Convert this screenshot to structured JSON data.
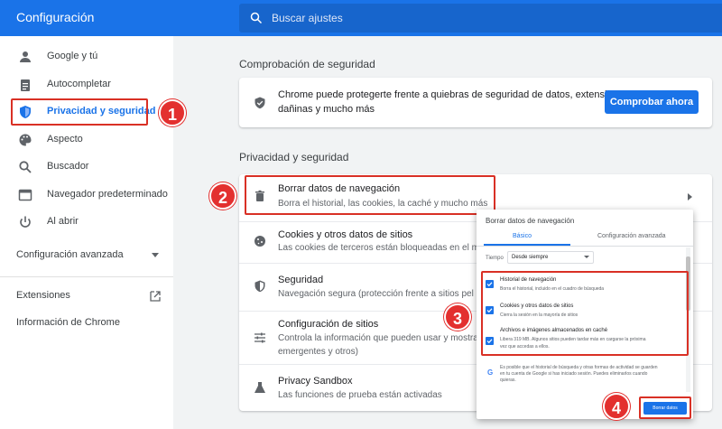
{
  "header": {
    "title": "Configuración",
    "search_placeholder": "Buscar ajustes"
  },
  "sidebar": {
    "items": [
      {
        "label": "Google y tú",
        "icon": "person-icon"
      },
      {
        "label": "Autocompletar",
        "icon": "clipboard-icon"
      },
      {
        "label": "Privacidad y seguridad",
        "icon": "shield-icon",
        "active": true
      },
      {
        "label": "Aspecto",
        "icon": "palette-icon"
      },
      {
        "label": "Buscador",
        "icon": "search-icon"
      },
      {
        "label": "Navegador predeterminado",
        "icon": "browser-window-icon"
      },
      {
        "label": "Al abrir",
        "icon": "power-icon"
      }
    ],
    "advanced_label": "Configuración avanzada",
    "extensions_label": "Extensiones",
    "about_label": "Información de Chrome"
  },
  "safety_check": {
    "section_title": "Comprobación de seguridad",
    "text_line1": "Chrome puede protegerte frente a quiebras de seguridad de datos, extensiones",
    "text_line2": "dañinas y mucho más",
    "button_label": "Comprobar ahora"
  },
  "privacy": {
    "section_title": "Privacidad y seguridad",
    "rows": [
      {
        "title": "Borrar datos de navegación",
        "subtitle": "Borra el historial, las cookies, la caché y mucho más",
        "icon": "trash-icon"
      },
      {
        "title": "Cookies y otros datos de sitios",
        "subtitle": "Las cookies de terceros están bloqueadas en el m",
        "icon": "cookie-icon"
      },
      {
        "title": "Seguridad",
        "subtitle": "Navegación segura (protección frente a sitios pel",
        "icon": "security-shield-icon"
      },
      {
        "title": "Configuración de sitios",
        "subtitle": "Controla la información que pueden usar y mostra",
        "subtitle2": "emergentes y otros)",
        "icon": "sliders-icon"
      },
      {
        "title": "Privacy Sandbox",
        "subtitle": "Las funciones de prueba están activadas",
        "icon": "flask-icon"
      }
    ]
  },
  "dialog": {
    "title": "Borrar datos de navegación",
    "tab_basic": "Básico",
    "tab_advanced": "Configuración avanzada",
    "range_label": "Tiempo",
    "range_value": "Desde siempre",
    "options": [
      {
        "title": "Historial de navegación",
        "subtitle": "Borra el historial, incluido en el cuadro de búsqueda"
      },
      {
        "title": "Cookies y otros datos de sitios",
        "subtitle": "Cierra la sesión en la mayoría de sitios"
      },
      {
        "title": "Archivos e imágenes almacenados en caché",
        "subtitle": "Libera 319 MB. Algunos sitios pueden tardar más en cargarse la próxima",
        "subtitle2": "vez que accedas a ellos."
      }
    ],
    "note": "Es posible que el historial de búsqueda y otras formas de actividad se guarden en tu cuenta de Google si has iniciado sesión. Puedes eliminarlos cuando quieras.",
    "button_label": "Borrar datos"
  },
  "annotations": [
    "1",
    "2",
    "3",
    "4"
  ],
  "colors": {
    "accent": "#1a73e8",
    "annotation": "#e3302f"
  }
}
